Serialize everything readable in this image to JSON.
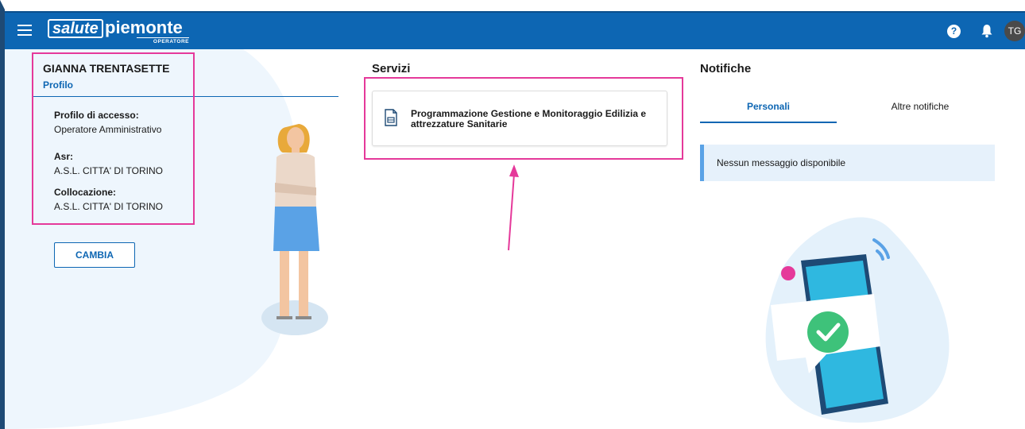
{
  "header": {
    "logo_box": "salute",
    "logo_word": "piemonte",
    "logo_sub": "OPERATORE",
    "help_glyph": "?",
    "avatar_initials": "TG",
    "bar_color": "#0d66b3"
  },
  "profile": {
    "name": "GIANNA TRENTASETTE",
    "link": "Profilo",
    "fields": [
      {
        "label": "Profilo di accesso:",
        "value": "Operatore Amministrativo"
      },
      {
        "label": "Asr:",
        "value": "A.S.L. CITTA' DI TORINO"
      },
      {
        "label": "Collocazione:",
        "value": "A.S.L. CITTA' DI TORINO"
      }
    ],
    "change_button": "CAMBIA"
  },
  "services": {
    "title": "Servizi",
    "items": [
      {
        "label": "Programmazione Gestione e Monitoraggio Edilizia e attrezzature Sanitarie",
        "icon": "document-icon"
      }
    ]
  },
  "notifications": {
    "title": "Notifiche",
    "tabs": [
      "Personali",
      "Altre notifiche"
    ],
    "active_tab": "Personali",
    "empty_message": "Nessun messaggio disponibile"
  },
  "annotation_color": "#e5399a"
}
